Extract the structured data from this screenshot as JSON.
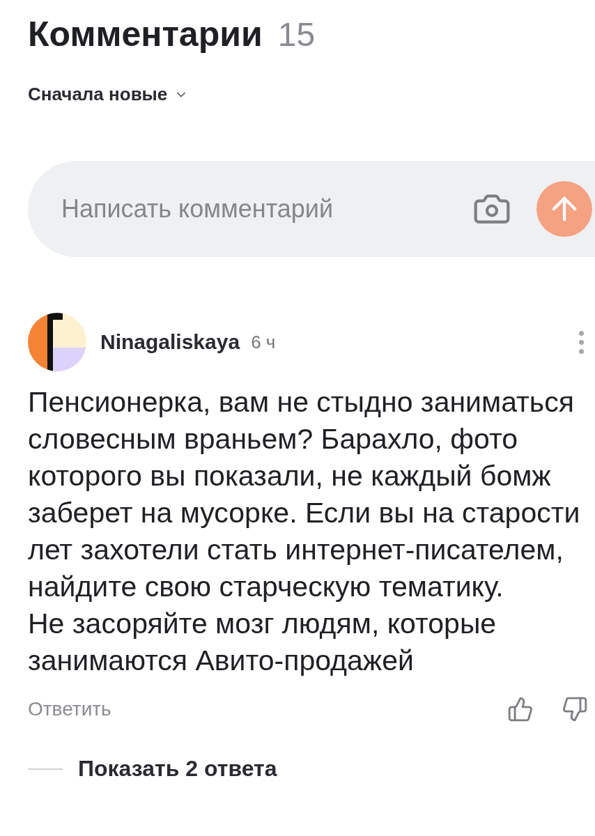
{
  "header": {
    "title": "Комментарии",
    "count": "15"
  },
  "sort": {
    "label": "Сначала новые"
  },
  "composer": {
    "placeholder": "Написать комментарий"
  },
  "comments": [
    {
      "author": "Ninagaliskaya",
      "time": "6 ч",
      "text": "Пенсионерка, вам не стыдно заниматься словесным враньем? Барахло, фото которого вы показали, не каждый бомж заберет на мусорке. Если вы на старости лет захотели стать интернет-писателем, найдите свою старческую тематику.\nНе засоряйте мозг людям, которые занимаются Авито-продажей",
      "reply": "Ответить",
      "show_replies": "Показать 2 ответа"
    }
  ]
}
